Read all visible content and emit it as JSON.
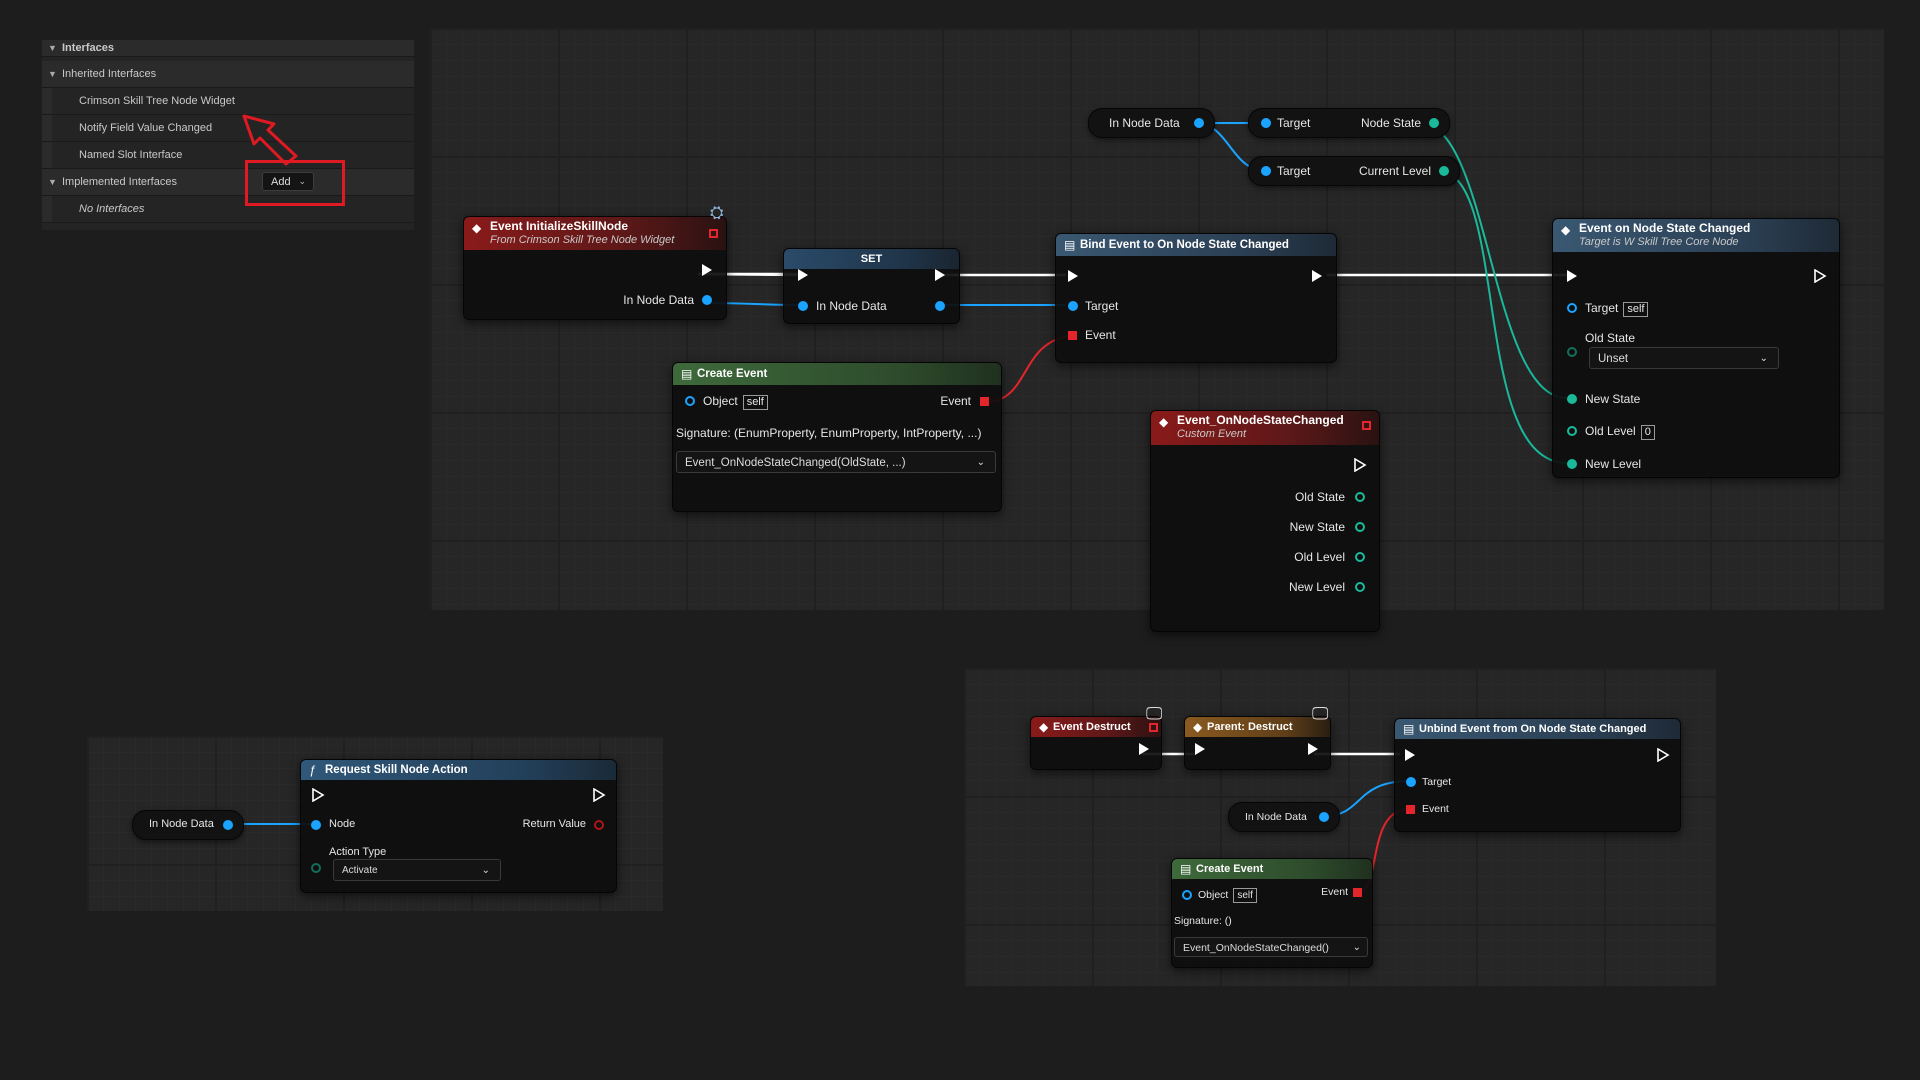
{
  "details_panel": {
    "section_title": "Interfaces",
    "inherited_category": "Inherited Interfaces",
    "inherited": [
      "Crimson Skill Tree Node Widget",
      "Notify Field Value Changed",
      "Named Slot Interface"
    ],
    "implemented_category": "Implemented Interfaces",
    "add_label": "Add",
    "no_interfaces": "No Interfaces"
  },
  "colors": {
    "exec": "#ffffff",
    "object_pin": "#1aa3ff",
    "enum_pin": "#19b99a",
    "delegate_pin": "#e4252b",
    "annotation": "#e01a22"
  },
  "graph_main": {
    "var_in_node_data": "In Node Data",
    "get_node_state": {
      "target": "Target",
      "output": "Node State"
    },
    "get_current_level": {
      "target": "Target",
      "output": "Current Level"
    },
    "event_initialize": {
      "title": "Event InitializeSkillNode",
      "subtitle": "From Crimson Skill Tree Node Widget",
      "pin_out": "In Node Data",
      "corner_icon": "interface-icon"
    },
    "set_node": {
      "title": "SET",
      "pin_in": "In Node Data"
    },
    "bind_event": {
      "title": "Bind Event to On Node State Changed",
      "target": "Target",
      "event": "Event"
    },
    "create_event": {
      "title": "Create Event",
      "object": "Object",
      "self": "self",
      "event": "Event",
      "signature": "Signature: (EnumProperty, EnumProperty, IntProperty, ...)",
      "function": "Event_OnNodeStateChanged(OldState, ...)"
    },
    "custom_event": {
      "title": "Event_OnNodeStateChanged",
      "subtitle": "Custom Event",
      "pins": [
        "Old State",
        "New State",
        "Old Level",
        "New Level"
      ]
    },
    "event_on_state_changed": {
      "title": "Event on Node State Changed",
      "subtitle": "Target is W Skill Tree Core Node",
      "target": "Target",
      "self": "self",
      "old_state": "Old State",
      "old_state_value": "Unset",
      "new_state": "New State",
      "old_level": "Old Level",
      "old_level_value": "0",
      "new_level": "New Level"
    }
  },
  "graph_request": {
    "var_in_node_data": "In Node Data",
    "node": {
      "title": "Request Skill Node Action",
      "node_pin": "Node",
      "return_value": "Return Value",
      "action_type": "Action Type",
      "action_value": "Activate"
    }
  },
  "graph_destruct": {
    "event_destruct": "Event Destruct",
    "parent_destruct": "Parent: Destruct",
    "unbind": {
      "title": "Unbind Event from On Node State Changed",
      "target": "Target",
      "event": "Event"
    },
    "var_in_node_data": "In Node Data",
    "create_event": {
      "title": "Create Event",
      "object": "Object",
      "self": "self",
      "event": "Event",
      "signature": "Signature: ()",
      "function": "Event_OnNodeStateChanged()"
    }
  }
}
